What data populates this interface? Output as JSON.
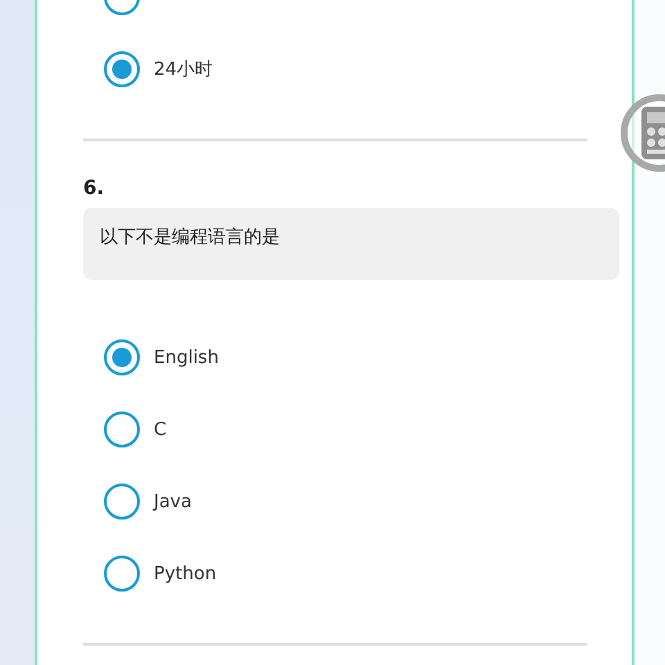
{
  "previous_question": {
    "options": [
      {
        "selected": false
      },
      {
        "label": "24小时",
        "selected": true
      }
    ]
  },
  "question": {
    "number": "6.",
    "text": "以下不是编程语言的是",
    "options": [
      {
        "label": "English",
        "selected": true
      },
      {
        "label": "C",
        "selected": false
      },
      {
        "label": "Java",
        "selected": false
      },
      {
        "label": "Python",
        "selected": false
      }
    ]
  }
}
